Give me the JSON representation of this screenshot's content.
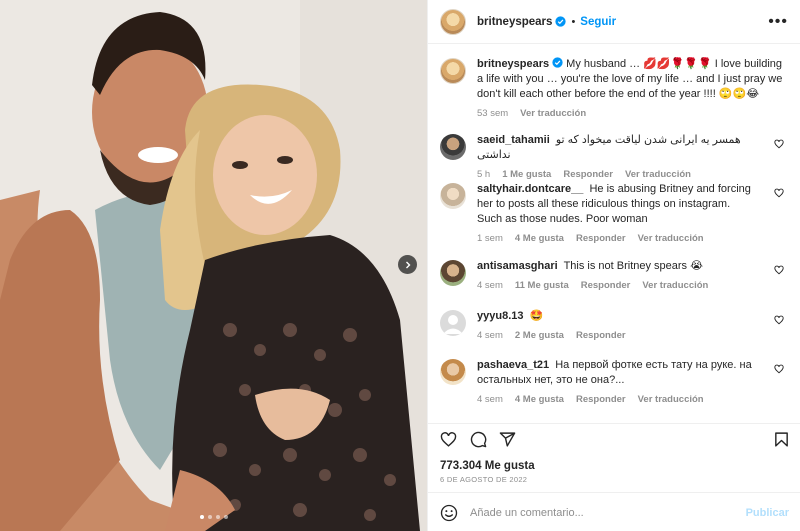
{
  "header": {
    "username": "britneyspears",
    "separator": "•",
    "follow_label": "Seguir",
    "more_label": "•••"
  },
  "caption": {
    "username": "britneyspears",
    "text": "My husband … 💋💋🌹🌹🌹 I love building a life with you … you're the love of my life … and I just pray we don't kill each other before the end of the year !!!! 🙄🙄😂",
    "age": "53 sem",
    "translate_label": "Ver traducción"
  },
  "comments": [
    {
      "username": "saeid_tahamii",
      "text": "همسر یه ایرانی شدن لیاقت میخواد که تو نداشتی",
      "age": "5 h",
      "likes": "1 Me gusta",
      "reply_label": "Responder",
      "translate_label": "Ver traducción"
    },
    {
      "username": "saltyhair.dontcare__",
      "text": "He is abusing Britney and forcing her to posts all these ridiculous things on instagram. Such as those nudes. Poor woman",
      "age": "1 sem",
      "likes": "4 Me gusta",
      "reply_label": "Responder",
      "translate_label": "Ver traducción"
    },
    {
      "username": "antisamasghari",
      "text": "This is not Britney spears 😭",
      "age": "4 sem",
      "likes": "11 Me gusta",
      "reply_label": "Responder",
      "translate_label": "Ver traducción"
    },
    {
      "username": "yyyu8.13",
      "text": "🤩",
      "age": "4 sem",
      "likes": "2 Me gusta",
      "reply_label": "Responder"
    },
    {
      "username": "pashaeva_t21",
      "text": "На первой фотке есть тату на руке. на остальных нет, это не она?...",
      "age": "4 sem",
      "likes": "4 Me gusta",
      "reply_label": "Responder",
      "translate_label": "Ver traducción"
    }
  ],
  "stats": {
    "likes": "773.304 Me gusta",
    "date": "6 DE AGOSTO DE 2022"
  },
  "add_comment": {
    "placeholder": "Añade un comentario...",
    "publish_label": "Publicar"
  },
  "carousel": {
    "slide_count": 4,
    "active_index": 0
  },
  "colors": {
    "accent": "#0095f6",
    "text": "#262626",
    "muted": "#8e8e8e",
    "publish_disabled": "#b2dffc"
  },
  "icons": [
    "more-icon",
    "verified-badge-icon",
    "heart-icon",
    "comment-icon",
    "share-icon",
    "bookmark-icon",
    "emoji-icon",
    "next-arrow-icon"
  ]
}
